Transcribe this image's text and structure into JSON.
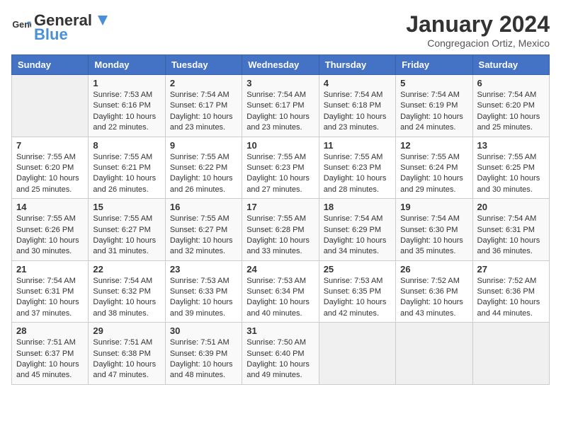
{
  "header": {
    "logo_general": "General",
    "logo_blue": "Blue",
    "month_year": "January 2024",
    "location": "Congregacion Ortiz, Mexico"
  },
  "days_of_week": [
    "Sunday",
    "Monday",
    "Tuesday",
    "Wednesday",
    "Thursday",
    "Friday",
    "Saturday"
  ],
  "weeks": [
    [
      {
        "day": "",
        "content": ""
      },
      {
        "day": "1",
        "content": "Sunrise: 7:53 AM\nSunset: 6:16 PM\nDaylight: 10 hours\nand 22 minutes."
      },
      {
        "day": "2",
        "content": "Sunrise: 7:54 AM\nSunset: 6:17 PM\nDaylight: 10 hours\nand 23 minutes."
      },
      {
        "day": "3",
        "content": "Sunrise: 7:54 AM\nSunset: 6:17 PM\nDaylight: 10 hours\nand 23 minutes."
      },
      {
        "day": "4",
        "content": "Sunrise: 7:54 AM\nSunset: 6:18 PM\nDaylight: 10 hours\nand 23 minutes."
      },
      {
        "day": "5",
        "content": "Sunrise: 7:54 AM\nSunset: 6:19 PM\nDaylight: 10 hours\nand 24 minutes."
      },
      {
        "day": "6",
        "content": "Sunrise: 7:54 AM\nSunset: 6:20 PM\nDaylight: 10 hours\nand 25 minutes."
      }
    ],
    [
      {
        "day": "7",
        "content": "Sunrise: 7:55 AM\nSunset: 6:20 PM\nDaylight: 10 hours\nand 25 minutes."
      },
      {
        "day": "8",
        "content": "Sunrise: 7:55 AM\nSunset: 6:21 PM\nDaylight: 10 hours\nand 26 minutes."
      },
      {
        "day": "9",
        "content": "Sunrise: 7:55 AM\nSunset: 6:22 PM\nDaylight: 10 hours\nand 26 minutes."
      },
      {
        "day": "10",
        "content": "Sunrise: 7:55 AM\nSunset: 6:23 PM\nDaylight: 10 hours\nand 27 minutes."
      },
      {
        "day": "11",
        "content": "Sunrise: 7:55 AM\nSunset: 6:23 PM\nDaylight: 10 hours\nand 28 minutes."
      },
      {
        "day": "12",
        "content": "Sunrise: 7:55 AM\nSunset: 6:24 PM\nDaylight: 10 hours\nand 29 minutes."
      },
      {
        "day": "13",
        "content": "Sunrise: 7:55 AM\nSunset: 6:25 PM\nDaylight: 10 hours\nand 30 minutes."
      }
    ],
    [
      {
        "day": "14",
        "content": "Sunrise: 7:55 AM\nSunset: 6:26 PM\nDaylight: 10 hours\nand 30 minutes."
      },
      {
        "day": "15",
        "content": "Sunrise: 7:55 AM\nSunset: 6:27 PM\nDaylight: 10 hours\nand 31 minutes."
      },
      {
        "day": "16",
        "content": "Sunrise: 7:55 AM\nSunset: 6:27 PM\nDaylight: 10 hours\nand 32 minutes."
      },
      {
        "day": "17",
        "content": "Sunrise: 7:55 AM\nSunset: 6:28 PM\nDaylight: 10 hours\nand 33 minutes."
      },
      {
        "day": "18",
        "content": "Sunrise: 7:54 AM\nSunset: 6:29 PM\nDaylight: 10 hours\nand 34 minutes."
      },
      {
        "day": "19",
        "content": "Sunrise: 7:54 AM\nSunset: 6:30 PM\nDaylight: 10 hours\nand 35 minutes."
      },
      {
        "day": "20",
        "content": "Sunrise: 7:54 AM\nSunset: 6:31 PM\nDaylight: 10 hours\nand 36 minutes."
      }
    ],
    [
      {
        "day": "21",
        "content": "Sunrise: 7:54 AM\nSunset: 6:31 PM\nDaylight: 10 hours\nand 37 minutes."
      },
      {
        "day": "22",
        "content": "Sunrise: 7:54 AM\nSunset: 6:32 PM\nDaylight: 10 hours\nand 38 minutes."
      },
      {
        "day": "23",
        "content": "Sunrise: 7:53 AM\nSunset: 6:33 PM\nDaylight: 10 hours\nand 39 minutes."
      },
      {
        "day": "24",
        "content": "Sunrise: 7:53 AM\nSunset: 6:34 PM\nDaylight: 10 hours\nand 40 minutes."
      },
      {
        "day": "25",
        "content": "Sunrise: 7:53 AM\nSunset: 6:35 PM\nDaylight: 10 hours\nand 42 minutes."
      },
      {
        "day": "26",
        "content": "Sunrise: 7:52 AM\nSunset: 6:36 PM\nDaylight: 10 hours\nand 43 minutes."
      },
      {
        "day": "27",
        "content": "Sunrise: 7:52 AM\nSunset: 6:36 PM\nDaylight: 10 hours\nand 44 minutes."
      }
    ],
    [
      {
        "day": "28",
        "content": "Sunrise: 7:51 AM\nSunset: 6:37 PM\nDaylight: 10 hours\nand 45 minutes."
      },
      {
        "day": "29",
        "content": "Sunrise: 7:51 AM\nSunset: 6:38 PM\nDaylight: 10 hours\nand 47 minutes."
      },
      {
        "day": "30",
        "content": "Sunrise: 7:51 AM\nSunset: 6:39 PM\nDaylight: 10 hours\nand 48 minutes."
      },
      {
        "day": "31",
        "content": "Sunrise: 7:50 AM\nSunset: 6:40 PM\nDaylight: 10 hours\nand 49 minutes."
      },
      {
        "day": "",
        "content": ""
      },
      {
        "day": "",
        "content": ""
      },
      {
        "day": "",
        "content": ""
      }
    ]
  ]
}
